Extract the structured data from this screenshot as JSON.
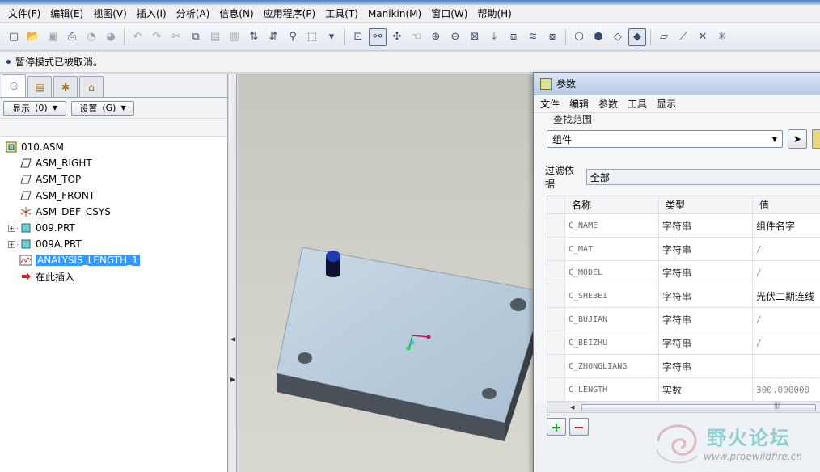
{
  "menubar": {
    "items": [
      "文件(F)",
      "编辑(E)",
      "视图(V)",
      "插入(I)",
      "分析(A)",
      "信息(N)",
      "应用程序(P)",
      "工具(T)",
      "Manikin(M)",
      "窗口(W)",
      "帮助(H)"
    ]
  },
  "status": {
    "message": "暂停模式已被取消。"
  },
  "leftpanel": {
    "show_button": "显示",
    "show_shortcut": "(0)",
    "settings_button": "设置",
    "settings_shortcut": "(G)",
    "tree": [
      {
        "label": "010.ASM",
        "icon": "assembly-icon"
      },
      {
        "label": "ASM_RIGHT",
        "icon": "datum-plane-icon"
      },
      {
        "label": "ASM_TOP",
        "icon": "datum-plane-icon"
      },
      {
        "label": "ASM_FRONT",
        "icon": "datum-plane-icon"
      },
      {
        "label": "ASM_DEF_CSYS",
        "icon": "csys-icon"
      },
      {
        "label": "009.PRT",
        "icon": "part-icon"
      },
      {
        "label": "009A.PRT",
        "icon": "part-icon"
      },
      {
        "label": "ANALYSIS_LENGTH_1",
        "icon": "analysis-icon"
      },
      {
        "label": "在此插入",
        "icon": "insert-arrow-icon"
      }
    ]
  },
  "param_window": {
    "title": "参数",
    "menu": [
      "文件",
      "编辑",
      "参数",
      "工具",
      "显示"
    ],
    "scope_label": "查找范围",
    "scope_value": "组件",
    "filter_label": "过滤依据",
    "filter_value": "全部",
    "columns": [
      "名称",
      "类型",
      "值"
    ],
    "rows": [
      {
        "name": "C_NAME",
        "type": "字符串",
        "value": "组件名字"
      },
      {
        "name": "C_MAT",
        "type": "字符串",
        "value": "/"
      },
      {
        "name": "C_MODEL",
        "type": "字符串",
        "value": "/"
      },
      {
        "name": "C_SHEBEI",
        "type": "字符串",
        "value": "光伏二期连线"
      },
      {
        "name": "C_BUJIAN",
        "type": "字符串",
        "value": "/"
      },
      {
        "name": "C_BEIZHU",
        "type": "字符串",
        "value": "/"
      },
      {
        "name": "C_ZHONGLIANG",
        "type": "字符串",
        "value": ""
      },
      {
        "name": "C_LENGTH",
        "type": "实数",
        "value": "300.000000"
      }
    ]
  },
  "watermark": {
    "text": "野火论坛",
    "url": "www.proewildfire.cn"
  }
}
